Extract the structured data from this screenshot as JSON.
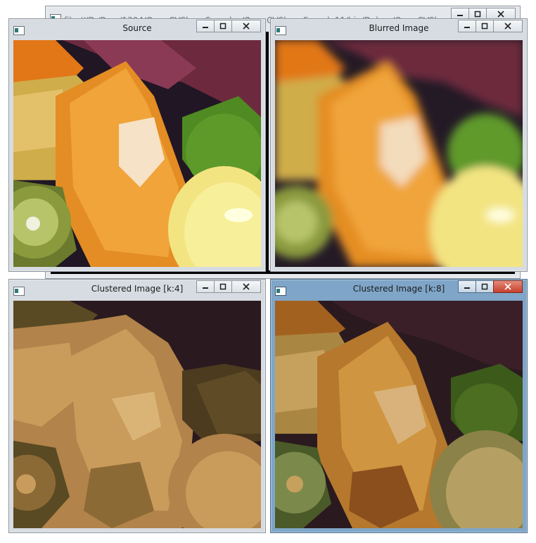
{
  "browser_window": {
    "address": "file:///D:/Prog/1394/OpenCVSharpSamples/OpenCVSharpSample11/bin/Debug/OpenCVSharpSampl"
  },
  "windows": [
    {
      "id": "source",
      "title": "Source",
      "active": false
    },
    {
      "id": "blurred",
      "title": "Blurred Image",
      "active": false
    },
    {
      "id": "clustered4",
      "title": "Clustered Image [k:4]",
      "active": false
    },
    {
      "id": "clustered8",
      "title": "Clustered Image [k:8]",
      "active": true
    }
  ],
  "colors": {
    "inactive_frame": "#d7dce2",
    "active_frame": "#7fa6c8",
    "close_active": "#c7402d"
  }
}
